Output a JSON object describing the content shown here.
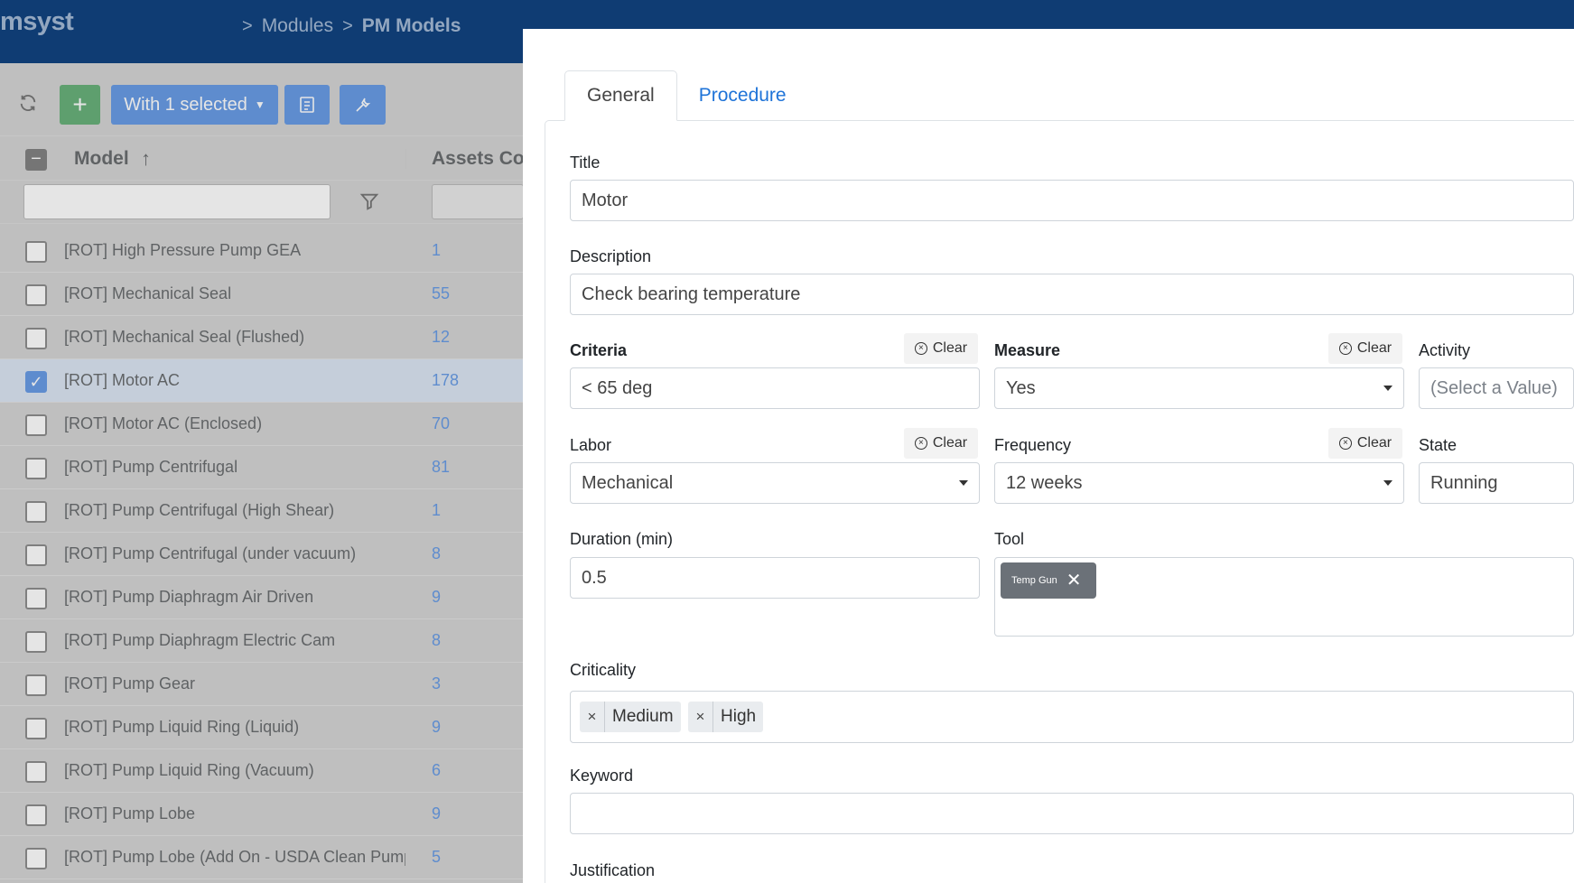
{
  "app": {
    "brand": "msyst"
  },
  "breadcrumb": {
    "sep": ">",
    "items": [
      "Modules",
      "PM Models"
    ]
  },
  "toolbar": {
    "refresh_icon": "refresh-icon",
    "add_label": "+",
    "with_selected_label": "With 1 selected",
    "export_icon": "export-icon",
    "tools_icon": "tools-icon"
  },
  "grid": {
    "columns": [
      "Model",
      "Assets Co"
    ],
    "sort_icon": "arrow-up-icon",
    "rows": [
      {
        "name": "[ROT] High Pressure Pump GEA",
        "count": "1",
        "selected": false
      },
      {
        "name": "[ROT] Mechanical Seal",
        "count": "55",
        "selected": false
      },
      {
        "name": "[ROT] Mechanical Seal (Flushed)",
        "count": "12",
        "selected": false
      },
      {
        "name": "[ROT] Motor AC",
        "count": "178",
        "selected": true
      },
      {
        "name": "[ROT] Motor AC (Enclosed)",
        "count": "70",
        "selected": false
      },
      {
        "name": "[ROT] Pump Centrifugal",
        "count": "81",
        "selected": false
      },
      {
        "name": "[ROT] Pump Centrifugal (High Shear)",
        "count": "1",
        "selected": false
      },
      {
        "name": "[ROT] Pump Centrifugal (under vacuum)",
        "count": "8",
        "selected": false
      },
      {
        "name": "[ROT] Pump Diaphragm Air Driven",
        "count": "9",
        "selected": false
      },
      {
        "name": "[ROT] Pump Diaphragm Electric Cam",
        "count": "8",
        "selected": false
      },
      {
        "name": "[ROT] Pump Gear",
        "count": "3",
        "selected": false
      },
      {
        "name": "[ROT] Pump Liquid Ring (Liquid)",
        "count": "9",
        "selected": false
      },
      {
        "name": "[ROT] Pump Liquid Ring (Vacuum)",
        "count": "6",
        "selected": false
      },
      {
        "name": "[ROT] Pump Lobe",
        "count": "9",
        "selected": false
      },
      {
        "name": "[ROT] Pump Lobe (Add On - USDA Clean Pump",
        "count": "5",
        "selected": false
      }
    ]
  },
  "modal": {
    "tabs": [
      "General",
      "Procedure"
    ],
    "clear_label": "Clear",
    "title": {
      "label": "Title",
      "value": "Motor"
    },
    "description": {
      "label": "Description",
      "value": "Check bearing temperature"
    },
    "criteria": {
      "label": "Criteria",
      "value": "< 65 deg"
    },
    "measure": {
      "label": "Measure",
      "value": "Yes"
    },
    "activity": {
      "label": "Activity",
      "placeholder": "(Select a Value)"
    },
    "labor": {
      "label": "Labor",
      "value": "Mechanical"
    },
    "frequency": {
      "label": "Frequency",
      "value": "12 weeks"
    },
    "state": {
      "label": "State",
      "value": "Running"
    },
    "duration": {
      "label": "Duration (min)",
      "value": "0.5"
    },
    "tool": {
      "label": "Tool",
      "chips": [
        "Temp Gun"
      ]
    },
    "criticality": {
      "label": "Criticality",
      "chips": [
        "Medium",
        "High"
      ]
    },
    "keyword": {
      "label": "Keyword",
      "value": ""
    },
    "justification": {
      "label": "Justification"
    }
  },
  "colors": {
    "header": "#0f3c73",
    "primary": "#1e6bd8",
    "success": "#1f8a3a",
    "chip": "#6b7178"
  }
}
